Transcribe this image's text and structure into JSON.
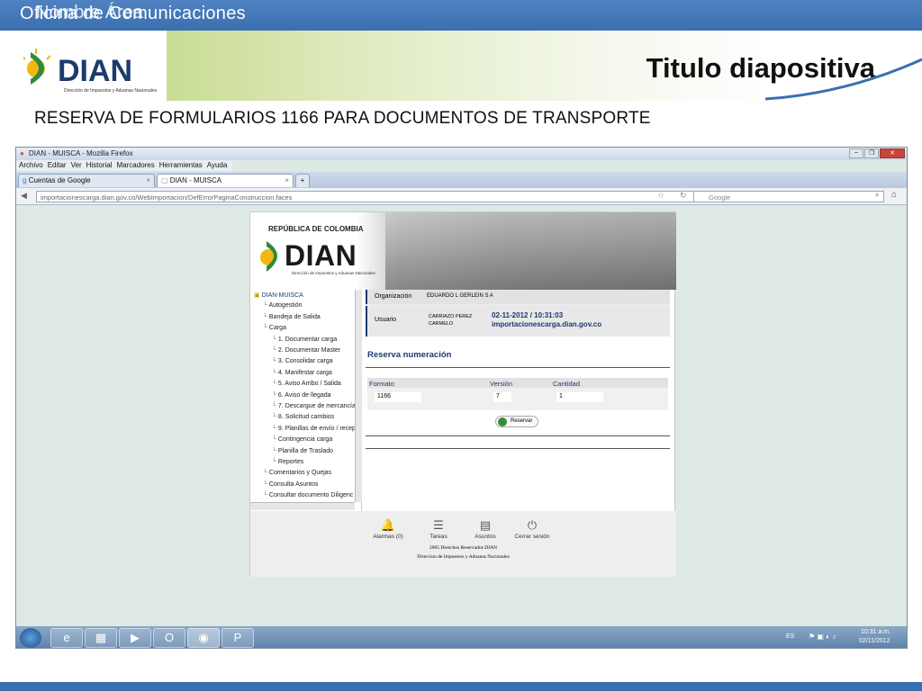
{
  "slide": {
    "header_text": "Oficina de Comunicaciones",
    "header_overlay": "Nombre Área",
    "logo_text": "DIAN",
    "logo_subtext": "Dirección de Impuestos y Aduanas Nacionales",
    "title": "Titulo diapositiva",
    "subtitle": "RESERVA DE FORMULARIOS 1166 PARA DOCUMENTOS DE TRANSPORTE"
  },
  "browser": {
    "window_title": "DIAN - MUISCA - Mozilla Firefox",
    "menu": [
      "Archivo",
      "Editar",
      "Ver",
      "Historial",
      "Marcadores",
      "Herramientas",
      "Ayuda"
    ],
    "tabs": [
      {
        "label": "Cuentas de Google"
      },
      {
        "label": "DIAN - MUISCA"
      }
    ],
    "new_tab": "+",
    "url": "importacionescarga.dian.gov.co/WebImportacion/DefErrorPaginaConstruccion.faces",
    "search_placeholder": "Google"
  },
  "webpage": {
    "banner_country": "REPÚBLICA DE COLOMBIA",
    "banner_logo": "DIAN",
    "banner_logo_sub": "Dirección de Impuestos y Aduanas Nacionales",
    "tree": [
      {
        "label": "DIAN-MUISCA",
        "level": 0
      },
      {
        "label": "Autogestión",
        "level": 1
      },
      {
        "label": "Bandeja de Salida",
        "level": 1
      },
      {
        "label": "Carga",
        "level": 1
      },
      {
        "label": "1. Documentar carga",
        "level": 2
      },
      {
        "label": "2. Documentar Master",
        "level": 2
      },
      {
        "label": "3. Consolidar carga",
        "level": 2
      },
      {
        "label": "4. Manifestar carga",
        "level": 2
      },
      {
        "label": "5. Aviso Arribo / Salida",
        "level": 2
      },
      {
        "label": "6. Aviso de llegada",
        "level": 2
      },
      {
        "label": "7. Descargue de mercancía",
        "level": 2
      },
      {
        "label": "8. Solicitud cambios",
        "level": 2
      },
      {
        "label": "9. Planillas de envío / recep",
        "level": 2
      },
      {
        "label": "Contingencia carga",
        "level": 2
      },
      {
        "label": "Planilla de Traslado",
        "level": 2
      },
      {
        "label": "Reportes",
        "level": 2
      },
      {
        "label": "Comentarios y Quejas",
        "level": 1
      },
      {
        "label": "Consulta Asuntos",
        "level": 1
      },
      {
        "label": "Consultar documento Diligenc",
        "level": 1
      }
    ],
    "org_label": "Organización",
    "org_value": "EDUARDO L GERLEIN S A",
    "user_label": "Usuario",
    "user_value_1": "CARRIAZO PEREZ",
    "user_value_2": "CARMELO",
    "datetime": "02-11-2012 / 10:31:03",
    "host": "importacionescarga.dian.gov.co",
    "section_title": "Reserva numeración",
    "col_formato": "Formato",
    "col_version": "Versión",
    "col_cantidad": "Cantidad",
    "val_formato": "1166",
    "val_version": "7",
    "val_cantidad": "1",
    "reservar_button": "Reservar",
    "footer_links": [
      "Alarmas (0)",
      "Tareas",
      "Asuntos",
      "Cerrar sesión"
    ],
    "footer_copy_1": "2005 Derechos Reservados DIAN",
    "footer_copy_2": "Direccion de Impuestos y Aduanas Nacionales"
  },
  "taskbar": {
    "lang": "ES",
    "time": "10:31 a.m.",
    "date": "02/11/2012"
  },
  "colors": {
    "header_blue": "#3a6fb0",
    "swoosh_green": "#c9dc94",
    "dian_blue": "#1c3a6e"
  }
}
